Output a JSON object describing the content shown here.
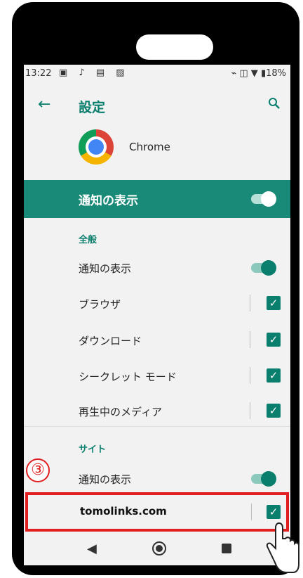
{
  "status_bar": {
    "time": "13:22",
    "notification_icons": "▣ ♪ ▤ ▨",
    "right_icons": "⌁ ◫ ▼ ▮18%"
  },
  "appbar": {
    "back_icon": "←",
    "title": "設定",
    "search_icon": "🔍"
  },
  "app": {
    "name": "Chrome"
  },
  "master_toggle": {
    "label": "通知の表示",
    "on": true
  },
  "general": {
    "header": "全般",
    "items": [
      {
        "label": "通知の表示",
        "control": "toggle",
        "on": true
      },
      {
        "label": "ブラウザ",
        "control": "checkbox",
        "checked": true
      },
      {
        "label": "ダウンロード",
        "control": "checkbox",
        "checked": true
      },
      {
        "label": "シークレット モード",
        "control": "checkbox",
        "checked": true
      },
      {
        "label": "再生中のメディア",
        "control": "checkbox",
        "checked": true
      }
    ]
  },
  "sites": {
    "header": "サイト",
    "toggle_label": "通知の表示",
    "site": "tomolinks.com"
  },
  "check_mark": "✓",
  "annotation": {
    "step": "③"
  },
  "colors": {
    "accent": "#0b7f6e",
    "banner": "#1a8a78",
    "highlight": "#e02020"
  }
}
